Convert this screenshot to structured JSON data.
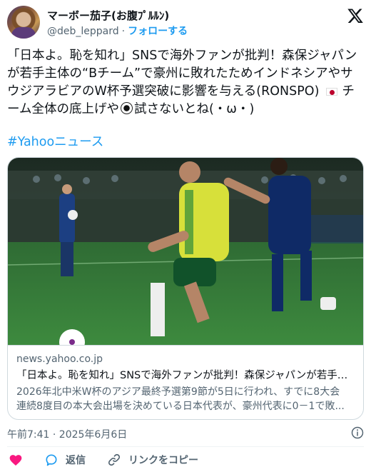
{
  "author": {
    "display_name": "マーボー茄子(お腹ﾌﾟﾙﾙﾝ)",
    "handle": "@deb_leppard",
    "separator": "·",
    "follow_label": "フォローする"
  },
  "tweet": {
    "text_part1": "「日本よ。恥を知れ」SNSで海外ファンが批判！森保ジャパンが若手主体の“Bチーム”で豪州に敗れたためインドネシアやサウジアラビアのW杯予選突破に影響を与える(RONSPO)",
    "text_part2": "チーム全体の底上げや",
    "text_part3": "試さないとね(・ω・)",
    "hashtag": "#Yahooニュース"
  },
  "card": {
    "domain": "news.yahoo.co.jp",
    "title": "「日本よ。恥を知れ」SNSで海外ファンが批判！森保ジャパンが若手主...",
    "desc_line1": "2026年北中米W杯のアジア最終予選第9節が5日に行われ、すでに8大会",
    "desc_line2": "連続8度目の本大会出場を決めている日本代表が、豪州代表に0－1で敗..."
  },
  "timestamp": "午前7:41 · 2025年6月6日",
  "actions": {
    "reply_label": "返信",
    "copy_link_label": "リンクをコピー"
  },
  "icons": [
    "x-logo-icon",
    "info-icon",
    "heart-icon",
    "reply-icon",
    "link-icon",
    "japan-flag-icon",
    "soccer-ball-icon"
  ],
  "colors": {
    "accent": "#1d9bf0",
    "like": "#f91880",
    "text": "#0f1419",
    "muted": "#536471"
  }
}
